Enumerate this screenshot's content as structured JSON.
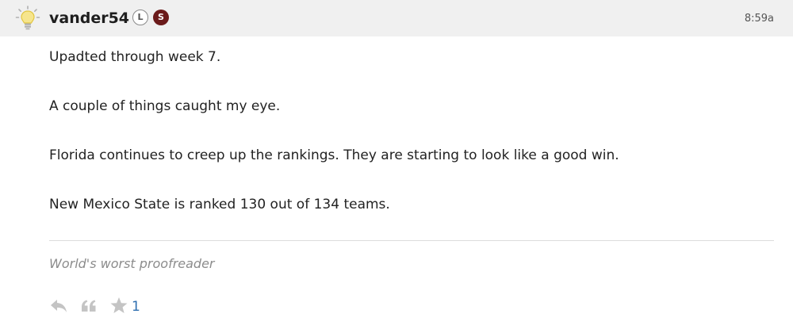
{
  "post": {
    "author": {
      "username": "vander54",
      "badges": [
        {
          "letter": "L",
          "color": "#ffffff"
        },
        {
          "letter": "S",
          "color": "#6b1a1a"
        }
      ],
      "avatar_icon": "lightbulb-icon"
    },
    "timestamp": "8:59a",
    "body": [
      "Upadted through week 7.",
      "A couple of things caught my eye.",
      "Florida continues to creep up the rankings. They are starting to look like a good win.",
      "New Mexico State is ranked 130 out of 134 teams."
    ],
    "signature": "World's worst proofreader",
    "actions": {
      "reply_icon": "reply-arrow-icon",
      "quote_icon": "quote-icon",
      "star_icon": "star-icon",
      "star_count": "1"
    }
  }
}
